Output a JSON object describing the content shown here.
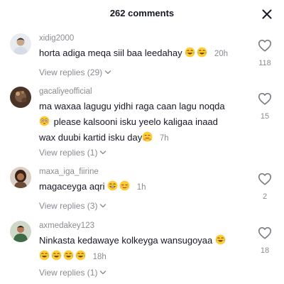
{
  "header": {
    "title": "262 comments"
  },
  "comments": [
    {
      "username": "xidig2000",
      "text": "horta adiga meqa siil baa leedahay",
      "emojis": [
        "laughing-tears",
        "laughing-tears"
      ],
      "time": "20h",
      "replies_label": "View replies (29)",
      "likes": "118"
    },
    {
      "username": "gacaliyeofficial",
      "line1": "ma waxaa lagugu yidhi raga caan lagu noqda",
      "line2": "please kalsooni isku yeelo kaligaa inaad",
      "line3": "wax duubi kartid isku day",
      "time": "7h",
      "replies_label": "View replies (1)",
      "likes": "15"
    },
    {
      "username": "maxa_iga_fiirine",
      "text": "magaceyga aqri",
      "time": "1h",
      "replies_label": "View replies (3)",
      "likes": "2"
    },
    {
      "username": "axmedakey123",
      "text": "Ninkasta kedawaye kolkeyga wansugoyaa",
      "time": "18h",
      "replies_label": "View replies (1)",
      "likes": "18"
    }
  ],
  "colors": {
    "text": "#161823",
    "muted": "#8a8b91",
    "background": "#ffffff"
  }
}
